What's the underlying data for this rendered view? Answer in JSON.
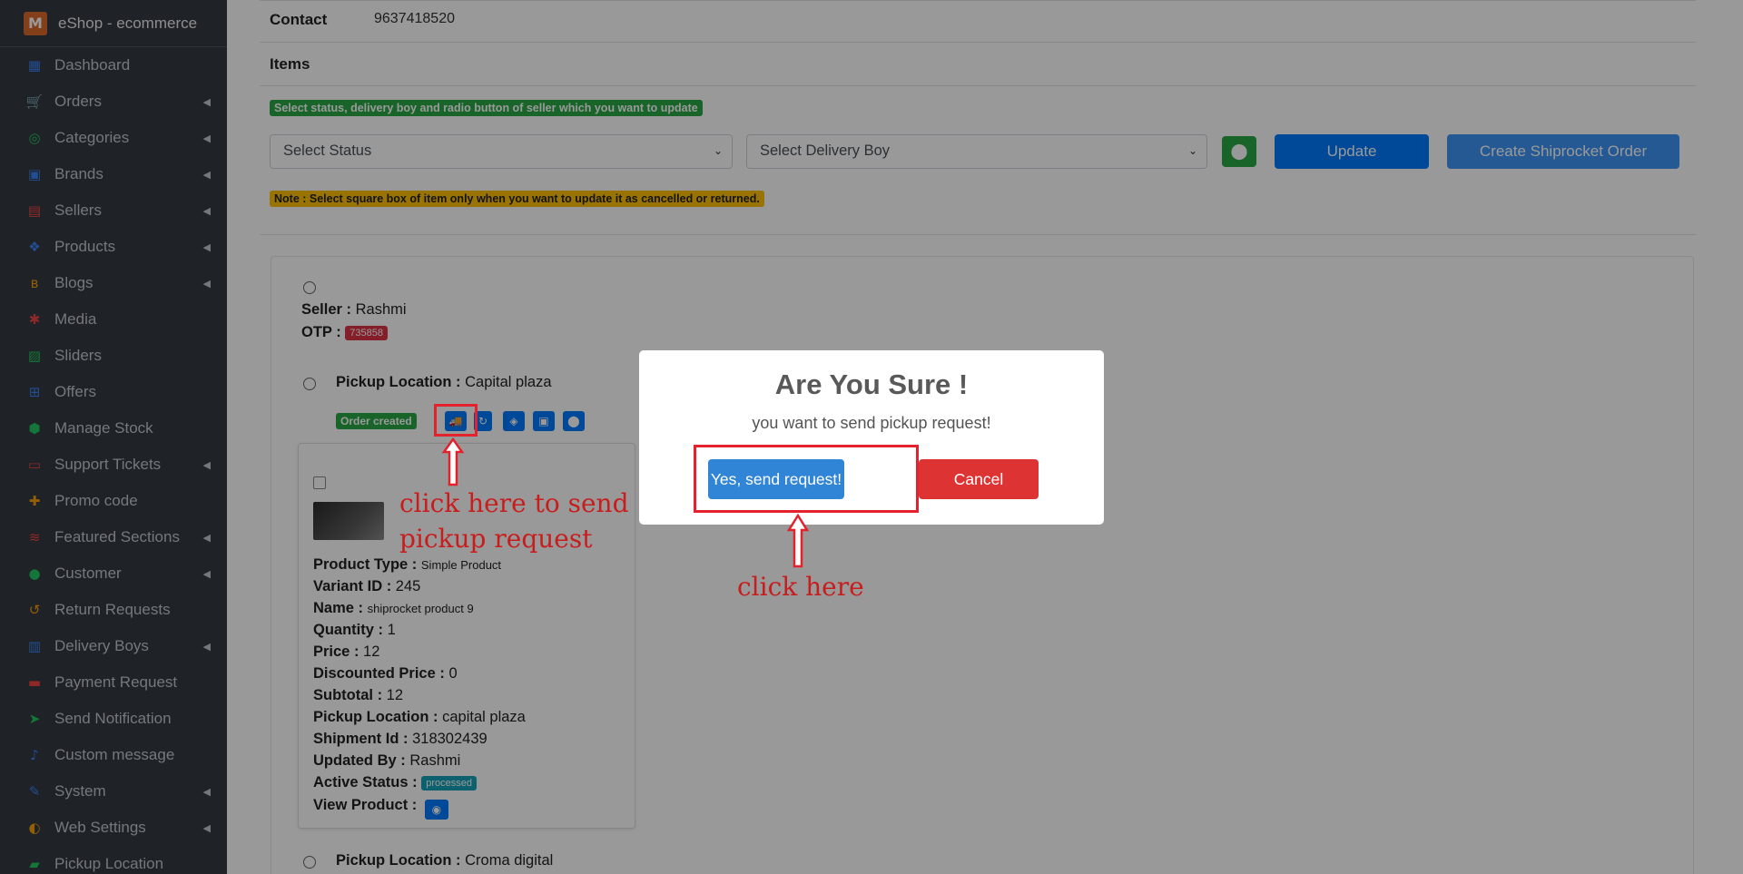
{
  "brand": {
    "name": "eShop - ecommerce",
    "logo_letter": "M"
  },
  "sidebar": {
    "items": [
      {
        "label": "Dashboard",
        "icon": "dashboard-icon",
        "glyph": "▦",
        "color": "#3b82f6",
        "arrow": false
      },
      {
        "label": "Orders",
        "icon": "cart-icon",
        "glyph": "🛒",
        "color": "#f59e0b",
        "arrow": true
      },
      {
        "label": "Categories",
        "icon": "circle-icon",
        "glyph": "◎",
        "color": "#22c55e",
        "arrow": true
      },
      {
        "label": "Brands",
        "icon": "brand-icon",
        "glyph": "▣",
        "color": "#3b82f6",
        "arrow": true
      },
      {
        "label": "Sellers",
        "icon": "store-icon",
        "glyph": "▤",
        "color": "#ef4444",
        "arrow": true
      },
      {
        "label": "Products",
        "icon": "cubes-icon",
        "glyph": "❖",
        "color": "#3b82f6",
        "arrow": true
      },
      {
        "label": "Blogs",
        "icon": "blog-icon",
        "glyph": "ʙ",
        "color": "#f59e0b",
        "arrow": true
      },
      {
        "label": "Media",
        "icon": "media-icon",
        "glyph": "✱",
        "color": "#ef4444",
        "arrow": false
      },
      {
        "label": "Sliders",
        "icon": "image-icon",
        "glyph": "▨",
        "color": "#22c55e",
        "arrow": false
      },
      {
        "label": "Offers",
        "icon": "gift-icon",
        "glyph": "⊞",
        "color": "#3b82f6",
        "arrow": false
      },
      {
        "label": "Manage Stock",
        "icon": "box-icon",
        "glyph": "⬢",
        "color": "#22c55e",
        "arrow": false
      },
      {
        "label": "Support Tickets",
        "icon": "ticket-icon",
        "glyph": "▭",
        "color": "#ef4444",
        "arrow": true
      },
      {
        "label": "Promo code",
        "icon": "puzzle-icon",
        "glyph": "✚",
        "color": "#f59e0b",
        "arrow": false
      },
      {
        "label": "Featured Sections",
        "icon": "layers-icon",
        "glyph": "≋",
        "color": "#ef4444",
        "arrow": true
      },
      {
        "label": "Customer",
        "icon": "user-icon",
        "glyph": "●",
        "color": "#22c55e",
        "arrow": true
      },
      {
        "label": "Return Requests",
        "icon": "undo-icon",
        "glyph": "↺",
        "color": "#f59e0b",
        "arrow": false
      },
      {
        "label": "Delivery Boys",
        "icon": "id-badge-icon",
        "glyph": "▥",
        "color": "#3b82f6",
        "arrow": true
      },
      {
        "label": "Payment Request",
        "icon": "money-icon",
        "glyph": "▬",
        "color": "#ef4444",
        "arrow": false
      },
      {
        "label": "Send Notification",
        "icon": "paper-plane-icon",
        "glyph": "➤",
        "color": "#22c55e",
        "arrow": false
      },
      {
        "label": "Custom message",
        "icon": "bell-icon",
        "glyph": "♪",
        "color": "#3b82f6",
        "arrow": false
      },
      {
        "label": "System",
        "icon": "wrench-icon",
        "glyph": "✎",
        "color": "#3b82f6",
        "arrow": true
      },
      {
        "label": "Web Settings",
        "icon": "globe-icon",
        "glyph": "◐",
        "color": "#f59e0b",
        "arrow": true
      },
      {
        "label": "Pickup Location",
        "icon": "truck-icon",
        "glyph": "▰",
        "color": "#22c55e",
        "arrow": false
      }
    ]
  },
  "order": {
    "contact_label": "Contact",
    "contact_value": "9637418520",
    "items_label": "Items",
    "instruction_badge": "Select status, delivery boy and radio button of seller which you want to update",
    "status_select": "Select Status",
    "delivery_select": "Select Delivery Boy",
    "update_button": "Update",
    "shiprocket_button": "Create Shiprocket Order",
    "note_badge": "Note : Select square box of item only when you want to update it as cancelled or returned."
  },
  "seller": {
    "seller_label": "Seller :",
    "seller_name": "Rashmi",
    "otp_label": "OTP :",
    "otp_value": "735858",
    "pickup_label": "Pickup Location :",
    "pickup_value": "Capital plaza",
    "order_status": "Order created",
    "pickup2_label": "Pickup Location :",
    "pickup2_value": "Croma digital"
  },
  "item": {
    "type_label": "Product Type :",
    "type_value": "Simple Product",
    "variant_label": "Variant ID :",
    "variant_value": "245",
    "name_label": "Name :",
    "name_value": "shiprocket product 9",
    "qty_label": "Quantity :",
    "qty_value": "1",
    "price_label": "Price :",
    "price_value": "12",
    "disc_label": "Discounted Price :",
    "disc_value": "0",
    "subtotal_label": "Subtotal :",
    "subtotal_value": "12",
    "ploc_label": "Pickup Location :",
    "ploc_value": "capital plaza",
    "ship_label": "Shipment Id :",
    "ship_value": "318302439",
    "upd_label": "Updated By :",
    "upd_value": "Rashmi",
    "active_label": "Active Status :",
    "active_value": "processed",
    "view_label": "View Product :"
  },
  "modal": {
    "title": "Are You Sure !",
    "text": "you want to send pickup request!",
    "confirm": "Yes, send request!",
    "cancel": "Cancel"
  },
  "annotations": {
    "pickup_hint_line1": "click here to send",
    "pickup_hint_line2": "pickup request",
    "click_here": "click here"
  },
  "colors": {
    "sidebar_bg": "#343a40",
    "primary": "#007bff",
    "success": "#28a745",
    "danger": "#dc3545",
    "confirm": "#3085d6",
    "cancel": "#dd3333",
    "annotation": "#e3222d"
  }
}
